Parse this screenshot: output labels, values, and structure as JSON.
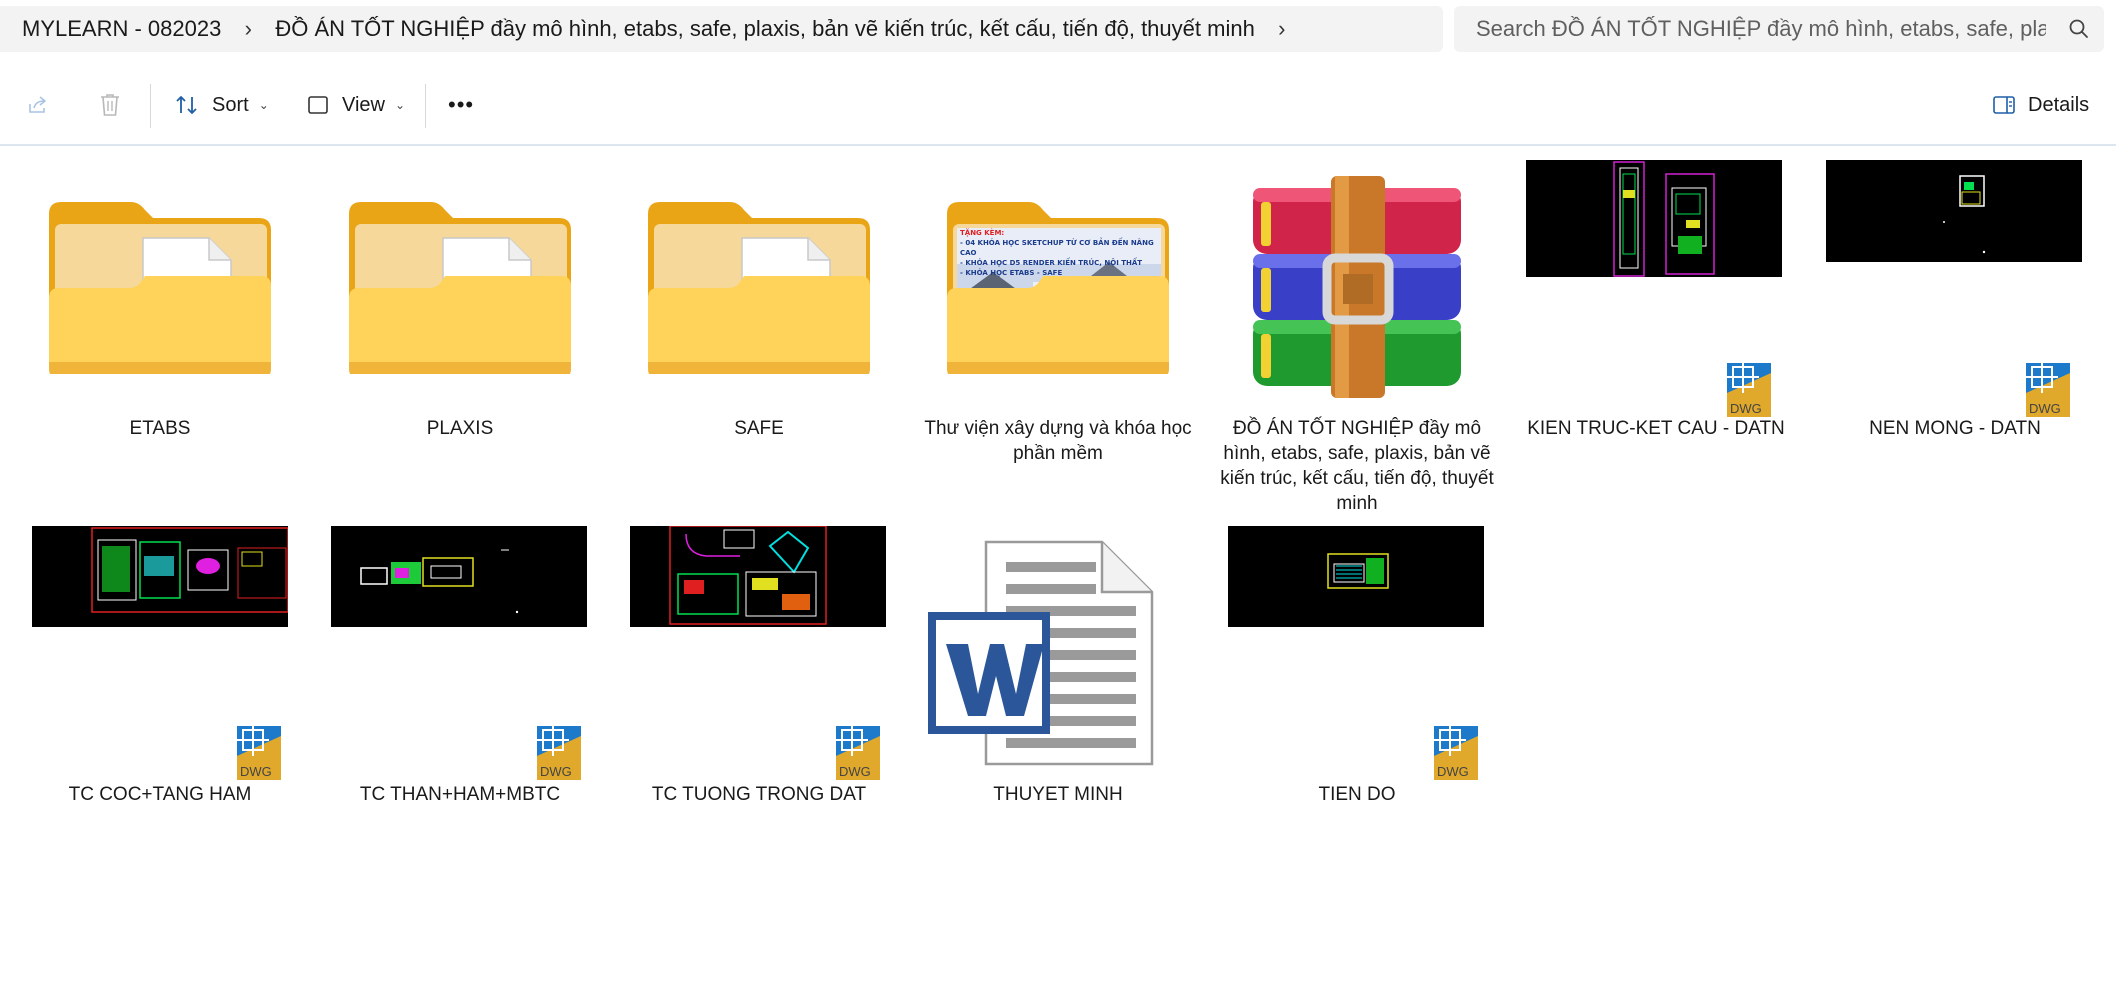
{
  "address": {
    "crumbs": [
      "MYLEARN - 082023",
      "ĐỒ ÁN TỐT NGHIỆP đầy mô hình, etabs, safe, plaxis, bản vẽ kiến trúc, kết cấu, tiến độ, thuyết minh"
    ],
    "separator": "›",
    "trailing_chevron": "›"
  },
  "search": {
    "placeholder": "Search ĐỒ ÁN TỐT NGHIỆP đầy mô hình, etabs, safe, plaxis, bản vẽ kiến trúc"
  },
  "toolbar": {
    "share_icon": "share-icon",
    "delete_icon": "trash-icon",
    "sort_label": "Sort",
    "view_label": "View",
    "more_label": "•••",
    "details_label": "Details"
  },
  "colors": {
    "folder_back": "#e9a516",
    "folder_front": "#ffd35a",
    "dwg_blue": "#1d79c9",
    "dwg_gold": "#e0a92c",
    "word_blue": "#2b579a",
    "accent": "#0067c0"
  },
  "files": [
    {
      "name": "ETABS",
      "kind": "folder"
    },
    {
      "name": "PLAXIS",
      "kind": "folder"
    },
    {
      "name": "SAFE",
      "kind": "folder"
    },
    {
      "name": "Thư viện xây dựng và khóa học phần mềm",
      "kind": "folder-preview",
      "preview_lines": [
        "TẶNG KÈM:",
        "- 04 KHÓA HỌC SKETCHUP TỪ CƠ BẢN ĐẾN NÂNG CAO",
        "- KHÓA HỌC D5 RENDER KIẾN TRÚC, NỘI THẤT",
        "- KHÓA HỌC ETABS - SAFE"
      ]
    },
    {
      "name": "ĐỒ ÁN TỐT NGHIỆP đầy mô hình, etabs, safe, plaxis, bản vẽ kiến trúc, kết cấu, tiến độ, thuyết minh",
      "kind": "winrar"
    },
    {
      "name": "KIEN TRUC-KET CAU - DATN",
      "kind": "dwg",
      "badge": "DWG"
    },
    {
      "name": "NEN MONG - DATN",
      "kind": "dwg",
      "badge": "DWG"
    },
    {
      "name": "TC COC+TANG HAM",
      "kind": "dwg",
      "badge": "DWG"
    },
    {
      "name": "TC THAN+HAM+MBTC",
      "kind": "dwg",
      "badge": "DWG"
    },
    {
      "name": "TC TUONG TRONG DAT",
      "kind": "dwg",
      "badge": "DWG"
    },
    {
      "name": "THUYET MINH",
      "kind": "word"
    },
    {
      "name": "TIEN DO",
      "kind": "dwg",
      "badge": "DWG"
    }
  ]
}
